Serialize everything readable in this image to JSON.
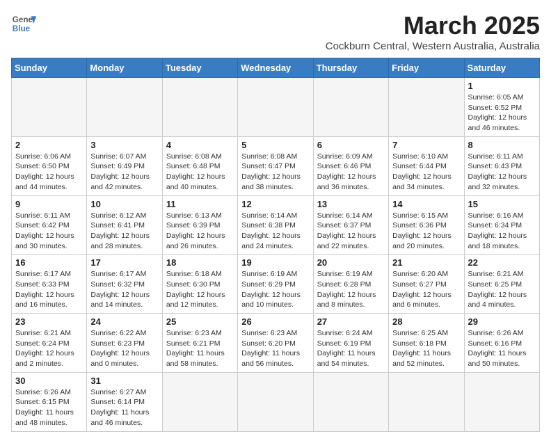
{
  "header": {
    "logo_general": "General",
    "logo_blue": "Blue",
    "month_title": "March 2025",
    "subtitle": "Cockburn Central, Western Australia, Australia"
  },
  "days_of_week": [
    "Sunday",
    "Monday",
    "Tuesday",
    "Wednesday",
    "Thursday",
    "Friday",
    "Saturday"
  ],
  "weeks": [
    [
      {
        "day": "",
        "info": ""
      },
      {
        "day": "",
        "info": ""
      },
      {
        "day": "",
        "info": ""
      },
      {
        "day": "",
        "info": ""
      },
      {
        "day": "",
        "info": ""
      },
      {
        "day": "",
        "info": ""
      },
      {
        "day": "1",
        "info": "Sunrise: 6:05 AM\nSunset: 6:52 PM\nDaylight: 12 hours and 46 minutes."
      }
    ],
    [
      {
        "day": "2",
        "info": "Sunrise: 6:06 AM\nSunset: 6:50 PM\nDaylight: 12 hours and 44 minutes."
      },
      {
        "day": "3",
        "info": "Sunrise: 6:07 AM\nSunset: 6:49 PM\nDaylight: 12 hours and 42 minutes."
      },
      {
        "day": "4",
        "info": "Sunrise: 6:08 AM\nSunset: 6:48 PM\nDaylight: 12 hours and 40 minutes."
      },
      {
        "day": "5",
        "info": "Sunrise: 6:08 AM\nSunset: 6:47 PM\nDaylight: 12 hours and 38 minutes."
      },
      {
        "day": "6",
        "info": "Sunrise: 6:09 AM\nSunset: 6:46 PM\nDaylight: 12 hours and 36 minutes."
      },
      {
        "day": "7",
        "info": "Sunrise: 6:10 AM\nSunset: 6:44 PM\nDaylight: 12 hours and 34 minutes."
      },
      {
        "day": "8",
        "info": "Sunrise: 6:11 AM\nSunset: 6:43 PM\nDaylight: 12 hours and 32 minutes."
      }
    ],
    [
      {
        "day": "9",
        "info": "Sunrise: 6:11 AM\nSunset: 6:42 PM\nDaylight: 12 hours and 30 minutes."
      },
      {
        "day": "10",
        "info": "Sunrise: 6:12 AM\nSunset: 6:41 PM\nDaylight: 12 hours and 28 minutes."
      },
      {
        "day": "11",
        "info": "Sunrise: 6:13 AM\nSunset: 6:39 PM\nDaylight: 12 hours and 26 minutes."
      },
      {
        "day": "12",
        "info": "Sunrise: 6:14 AM\nSunset: 6:38 PM\nDaylight: 12 hours and 24 minutes."
      },
      {
        "day": "13",
        "info": "Sunrise: 6:14 AM\nSunset: 6:37 PM\nDaylight: 12 hours and 22 minutes."
      },
      {
        "day": "14",
        "info": "Sunrise: 6:15 AM\nSunset: 6:36 PM\nDaylight: 12 hours and 20 minutes."
      },
      {
        "day": "15",
        "info": "Sunrise: 6:16 AM\nSunset: 6:34 PM\nDaylight: 12 hours and 18 minutes."
      }
    ],
    [
      {
        "day": "16",
        "info": "Sunrise: 6:17 AM\nSunset: 6:33 PM\nDaylight: 12 hours and 16 minutes."
      },
      {
        "day": "17",
        "info": "Sunrise: 6:17 AM\nSunset: 6:32 PM\nDaylight: 12 hours and 14 minutes."
      },
      {
        "day": "18",
        "info": "Sunrise: 6:18 AM\nSunset: 6:30 PM\nDaylight: 12 hours and 12 minutes."
      },
      {
        "day": "19",
        "info": "Sunrise: 6:19 AM\nSunset: 6:29 PM\nDaylight: 12 hours and 10 minutes."
      },
      {
        "day": "20",
        "info": "Sunrise: 6:19 AM\nSunset: 6:28 PM\nDaylight: 12 hours and 8 minutes."
      },
      {
        "day": "21",
        "info": "Sunrise: 6:20 AM\nSunset: 6:27 PM\nDaylight: 12 hours and 6 minutes."
      },
      {
        "day": "22",
        "info": "Sunrise: 6:21 AM\nSunset: 6:25 PM\nDaylight: 12 hours and 4 minutes."
      }
    ],
    [
      {
        "day": "23",
        "info": "Sunrise: 6:21 AM\nSunset: 6:24 PM\nDaylight: 12 hours and 2 minutes."
      },
      {
        "day": "24",
        "info": "Sunrise: 6:22 AM\nSunset: 6:23 PM\nDaylight: 12 hours and 0 minutes."
      },
      {
        "day": "25",
        "info": "Sunrise: 6:23 AM\nSunset: 6:21 PM\nDaylight: 11 hours and 58 minutes."
      },
      {
        "day": "26",
        "info": "Sunrise: 6:23 AM\nSunset: 6:20 PM\nDaylight: 11 hours and 56 minutes."
      },
      {
        "day": "27",
        "info": "Sunrise: 6:24 AM\nSunset: 6:19 PM\nDaylight: 11 hours and 54 minutes."
      },
      {
        "day": "28",
        "info": "Sunrise: 6:25 AM\nSunset: 6:18 PM\nDaylight: 11 hours and 52 minutes."
      },
      {
        "day": "29",
        "info": "Sunrise: 6:26 AM\nSunset: 6:16 PM\nDaylight: 11 hours and 50 minutes."
      }
    ],
    [
      {
        "day": "30",
        "info": "Sunrise: 6:26 AM\nSunset: 6:15 PM\nDaylight: 11 hours and 48 minutes."
      },
      {
        "day": "31",
        "info": "Sunrise: 6:27 AM\nSunset: 6:14 PM\nDaylight: 11 hours and 46 minutes."
      },
      {
        "day": "",
        "info": ""
      },
      {
        "day": "",
        "info": ""
      },
      {
        "day": "",
        "info": ""
      },
      {
        "day": "",
        "info": ""
      },
      {
        "day": "",
        "info": ""
      }
    ]
  ]
}
